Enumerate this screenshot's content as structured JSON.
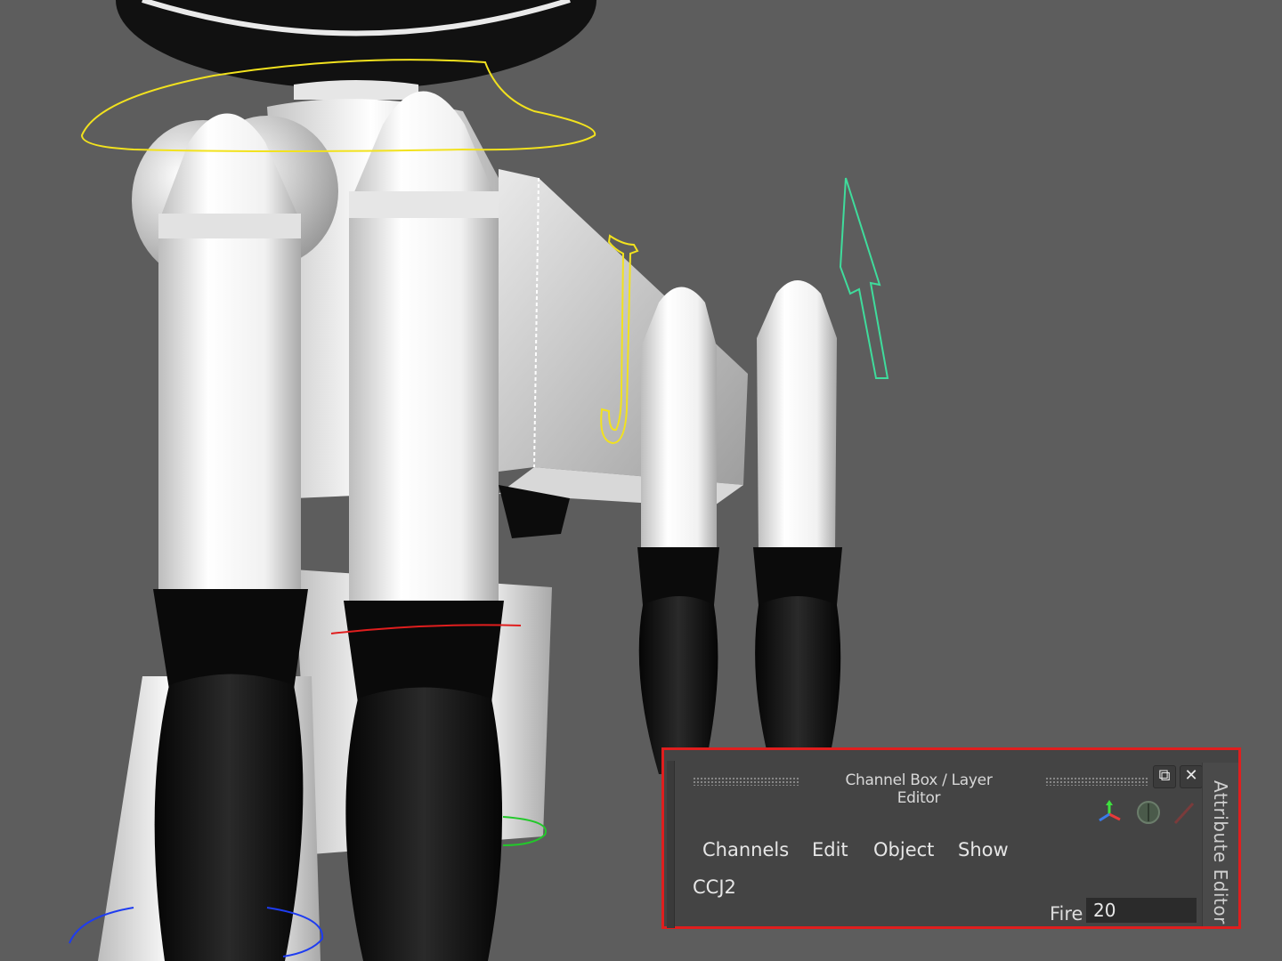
{
  "panel": {
    "title": "Channel Box / Layer Editor",
    "menus": [
      "Channels",
      "Edit",
      "Object",
      "Show"
    ],
    "object_name": "CCJ2",
    "attribute": {
      "label": "Fire",
      "value": "20"
    },
    "side_tab": "Attribute Editor",
    "float_glyph": "⧉",
    "close_glyph": "✕"
  },
  "colors": {
    "viewport_bg": "#5d5d5d",
    "selection_highlight": "#e01e1e",
    "curve_yellow": "#f2e21e",
    "curve_green": "#3fdc9c"
  },
  "icons": [
    "float-window-icon",
    "close-icon",
    "axis-manipulator-icon",
    "channel-toggle-icon",
    "slash-icon"
  ]
}
